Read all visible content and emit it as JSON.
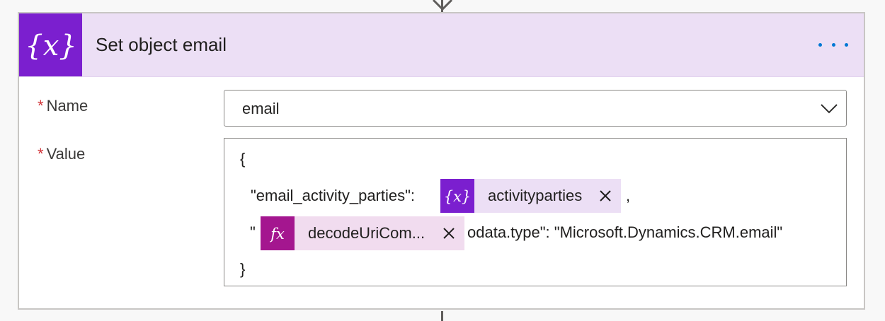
{
  "action": {
    "title": "Set object email",
    "more_icon": "more-horizontal-icon",
    "header_icon": "variable-curly-x-icon",
    "accent_color": "#7b1fcf",
    "header_bg": "#ecdff5"
  },
  "fields": {
    "name": {
      "required_mark": "*",
      "label": "Name",
      "value": "email"
    },
    "value": {
      "required_mark": "*",
      "label": "Value",
      "line1": "{",
      "line2_prefix": "\"email_activity_parties\":",
      "line2_suffix": ",",
      "line3_prefix": "\"",
      "line3_suffix": "odata.type\": \"Microsoft.Dynamics.CRM.email\"",
      "line4": "}",
      "token_variable": {
        "label": "activityparties",
        "icon": "variable-curly-x-icon",
        "color": "#7b1fcf"
      },
      "token_expression": {
        "label": "decodeUriCom...",
        "icon": "fx-expression-icon",
        "color": "#a4168f"
      }
    }
  }
}
